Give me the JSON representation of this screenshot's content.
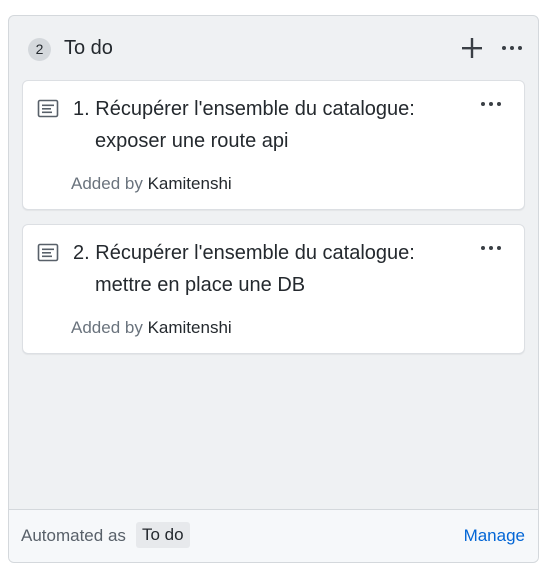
{
  "column": {
    "count": "2",
    "title": "To do",
    "add_icon": "plus-icon",
    "more_icon": "kebab-horizontal-icon"
  },
  "cards": [
    {
      "number": "1.",
      "title_line1": "Récupérer l'ensemble du catalogue:",
      "title_line2": "exposer une route api",
      "added_by_label": "Added by",
      "author": "Kamitenshi",
      "icon": "note-icon"
    },
    {
      "number": "2.",
      "title_line1": "Récupérer l'ensemble du catalogue:",
      "title_line2": "mettre en place une DB",
      "added_by_label": "Added by",
      "author": "Kamitenshi",
      "icon": "note-icon"
    }
  ],
  "footer": {
    "automated_label": "Automated as",
    "automated_value": "To do",
    "manage_label": "Manage"
  },
  "colors": {
    "column_bg": "#eff1f3",
    "link": "#0366d6",
    "muted_text": "#6a737d",
    "text": "#24292e"
  }
}
